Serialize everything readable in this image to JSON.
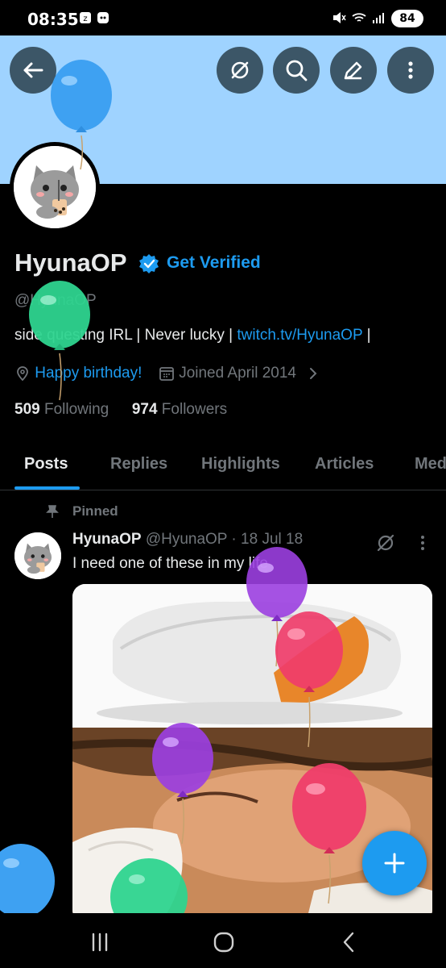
{
  "status_bar": {
    "time": "08:35",
    "battery": "84"
  },
  "profile": {
    "display_name": "HyunaOP",
    "get_verified": "Get Verified",
    "handle": "@HyunaOP",
    "bio_text": "side questing IRL | Never lucky | ",
    "bio_link": "twitch.tv/HyunaOP",
    "bio_end": " |",
    "location": "Happy birthday!",
    "joined": "Joined April 2014",
    "following_count": "509",
    "following_label": "Following",
    "followers_count": "974",
    "followers_label": "Followers"
  },
  "tabs": [
    "Posts",
    "Replies",
    "Highlights",
    "Articles",
    "Med"
  ],
  "post": {
    "pinned_label": "Pinned",
    "author": "HyunaOP",
    "handle": "@HyunaOP",
    "date": "· 18 Jul 18",
    "text": "I need one of these in my life"
  },
  "icons": {
    "back": "back-arrow-icon",
    "grok": "grok-icon",
    "search": "search-icon",
    "edit": "edit-icon",
    "more": "more-vertical-icon",
    "verified": "verified-badge-icon",
    "location": "location-pin-icon",
    "calendar": "calendar-icon",
    "pin": "pin-icon",
    "compose": "plus-icon"
  },
  "colors": {
    "accent": "#1d9bf0",
    "banner": "#9fd3ff",
    "background": "#000000",
    "muted": "#71767b"
  }
}
